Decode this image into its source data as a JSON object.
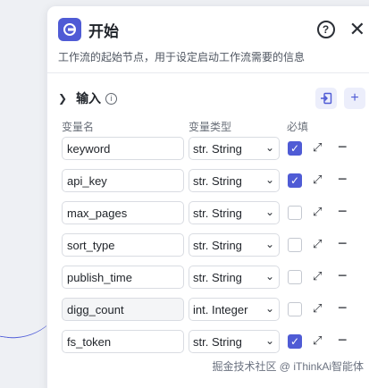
{
  "node": {
    "title": "开始",
    "description": "工作流的起始节点，用于设定启动工作流需要的信息",
    "help_icon": "question-circle-icon",
    "close_symbol": "✕"
  },
  "input_section": {
    "title": "输入",
    "info_symbol": "i",
    "columns": {
      "name": "变量名",
      "type": "变量类型",
      "required": "必填"
    },
    "rows": [
      {
        "name": "keyword",
        "type": "str. String",
        "required": true,
        "filled": false
      },
      {
        "name": "api_key",
        "type": "str. String",
        "required": true,
        "filled": false
      },
      {
        "name": "max_pages",
        "type": "str. String",
        "required": false,
        "filled": false
      },
      {
        "name": "sort_type",
        "type": "str. String",
        "required": false,
        "filled": false
      },
      {
        "name": "publish_time",
        "type": "str. String",
        "required": false,
        "filled": false
      },
      {
        "name": "digg_count",
        "type": "int. Integer",
        "required": false,
        "filled": true
      },
      {
        "name": "fs_token",
        "type": "str. String",
        "required": true,
        "filled": false
      }
    ]
  },
  "watermark": "掘金技术社区 @ iThinkAi智能体",
  "colors": {
    "accent": "#4f5bd5"
  }
}
